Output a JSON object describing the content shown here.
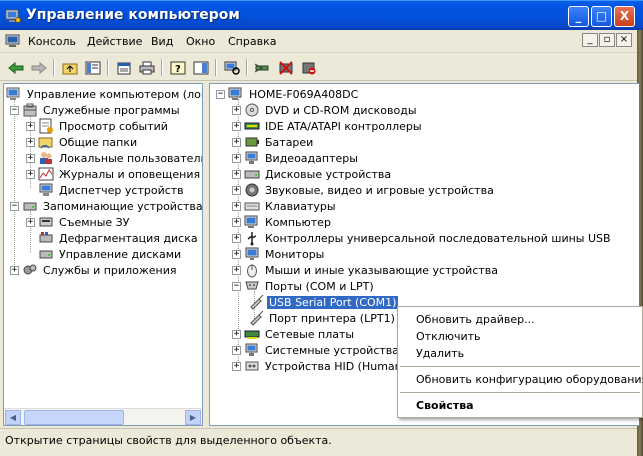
{
  "window": {
    "title": "Управление компьютером",
    "buttons": {
      "minimize": "_",
      "maximize": "□",
      "close": "X"
    }
  },
  "menu": [
    "Консоль",
    "Действие",
    "Вид",
    "Окно",
    "Справка"
  ],
  "left_tree": [
    {
      "label": "Управление компьютером (локаль",
      "icon": "computer-management-icon",
      "expander": "minus"
    },
    {
      "label": "Служебные программы",
      "icon": "tools-icon",
      "expander": "minus"
    },
    {
      "label": "Просмотр событий",
      "icon": "event-viewer-icon",
      "expander": "plus"
    },
    {
      "label": "Общие папки",
      "icon": "shared-folders-icon",
      "expander": "plus"
    },
    {
      "label": "Локальные пользователи",
      "icon": "users-icon",
      "expander": "plus"
    },
    {
      "label": "Журналы и оповещения пр",
      "icon": "performance-logs-icon",
      "expander": "plus"
    },
    {
      "label": "Диспетчер устройств",
      "icon": "device-manager-icon",
      "expander": ""
    },
    {
      "label": "Запоминающие устройства",
      "icon": "storage-icon",
      "expander": "minus"
    },
    {
      "label": "Съемные ЗУ",
      "icon": "removable-storage-icon",
      "expander": "plus"
    },
    {
      "label": "Дефрагментация диска",
      "icon": "defrag-icon",
      "expander": ""
    },
    {
      "label": "Управление дисками",
      "icon": "disk-management-icon",
      "expander": ""
    },
    {
      "label": "Службы и приложения",
      "icon": "services-icon",
      "expander": "plus"
    }
  ],
  "right_tree": [
    {
      "label": "HOME-F069A408DC",
      "icon": "computer-icon",
      "expander": "minus"
    },
    {
      "label": "DVD и CD-ROM дисководы",
      "icon": "cdrom-icon",
      "expander": "plus"
    },
    {
      "label": "IDE ATA/ATAPI контроллеры",
      "icon": "ide-controller-icon",
      "expander": "plus"
    },
    {
      "label": "Батареи",
      "icon": "battery-icon",
      "expander": "plus"
    },
    {
      "label": "Видеоадаптеры",
      "icon": "display-adapter-icon",
      "expander": "plus"
    },
    {
      "label": "Дисковые устройства",
      "icon": "disk-drive-icon",
      "expander": "plus"
    },
    {
      "label": "Звуковые, видео и игровые устройства",
      "icon": "sound-icon",
      "expander": "plus"
    },
    {
      "label": "Клавиатуры",
      "icon": "keyboard-icon",
      "expander": "plus"
    },
    {
      "label": "Компьютер",
      "icon": "computer-icon",
      "expander": "plus"
    },
    {
      "label": "Контроллеры универсальной последовательной шины USB",
      "icon": "usb-icon",
      "expander": "plus"
    },
    {
      "label": "Мониторы",
      "icon": "monitor-icon",
      "expander": "plus"
    },
    {
      "label": "Мыши и иные указывающие устройства",
      "icon": "mouse-icon",
      "expander": "plus"
    },
    {
      "label": "Порты (COM и LPT)",
      "icon": "ports-icon",
      "expander": "minus"
    },
    {
      "label": "USB Serial Port (COM1)",
      "icon": "port-connector-icon",
      "expander": ""
    },
    {
      "label": "Порт принтера (LPT1)",
      "icon": "port-connector-icon",
      "expander": ""
    },
    {
      "label": "Сетевые платы",
      "icon": "network-adapter-icon",
      "expander": "plus"
    },
    {
      "label": "Системные устройства",
      "icon": "system-device-icon",
      "expander": "plus"
    },
    {
      "label": "Устройства HID (Human Interface Devices)",
      "icon": "hid-icon",
      "expander": "plus"
    }
  ],
  "context_menu": [
    {
      "label": "Обновить драйвер...",
      "bold": false
    },
    {
      "label": "Отключить",
      "bold": false
    },
    {
      "label": "Удалить",
      "bold": false
    },
    {
      "label": "Обновить конфигурацию оборудования",
      "bold": false
    },
    {
      "label": "Свойства",
      "bold": true
    }
  ],
  "status_text": "Открытие страницы свойств для выделенного объекта.",
  "colors": {
    "title_blue": "#0054e3",
    "selection": "#316ac5",
    "face": "#ece9d8"
  }
}
